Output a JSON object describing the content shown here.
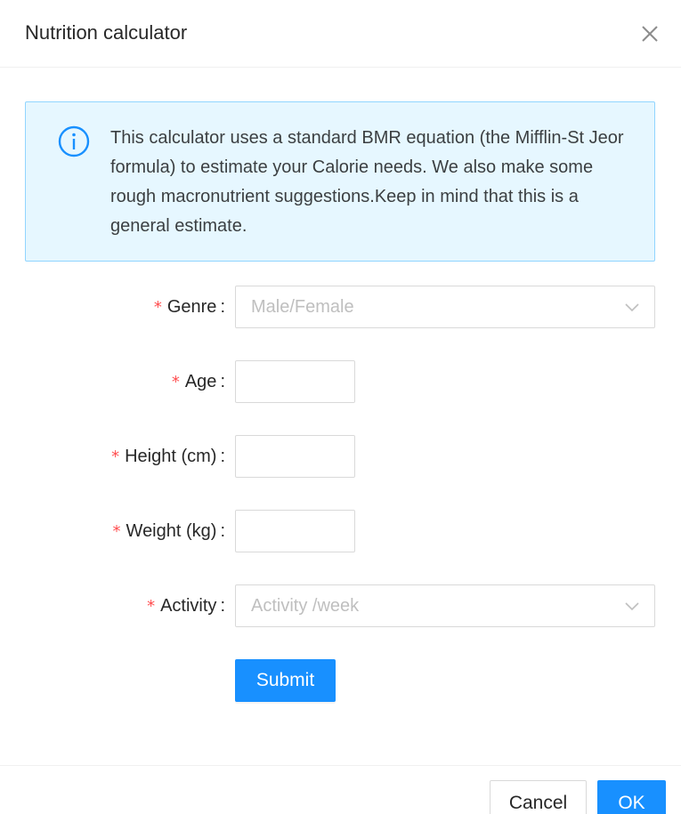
{
  "modal": {
    "title": "Nutrition calculator"
  },
  "alert": {
    "text": "This calculator uses a standard BMR equation (the Mifflin-St Jeor formula) to estimate your Calorie needs. We also make some rough macronutrient suggestions.Keep in mind that this is a general estimate.",
    "icon": "info-circle-icon"
  },
  "form": {
    "required_mark": "*",
    "colon": ":",
    "genre": {
      "label": "Genre",
      "placeholder": "Male/Female"
    },
    "age": {
      "label": "Age",
      "value": ""
    },
    "height": {
      "label": "Height (cm)",
      "value": ""
    },
    "weight": {
      "label": "Weight (kg)",
      "value": ""
    },
    "activity": {
      "label": "Activity",
      "placeholder": "Activity /week"
    },
    "submit_label": "Submit"
  },
  "footer": {
    "cancel_label": "Cancel",
    "ok_label": "OK"
  },
  "colors": {
    "primary": "#1890ff",
    "required": "#ff4d4f",
    "alert_bg": "#e6f7ff",
    "alert_border": "#91d5ff"
  }
}
